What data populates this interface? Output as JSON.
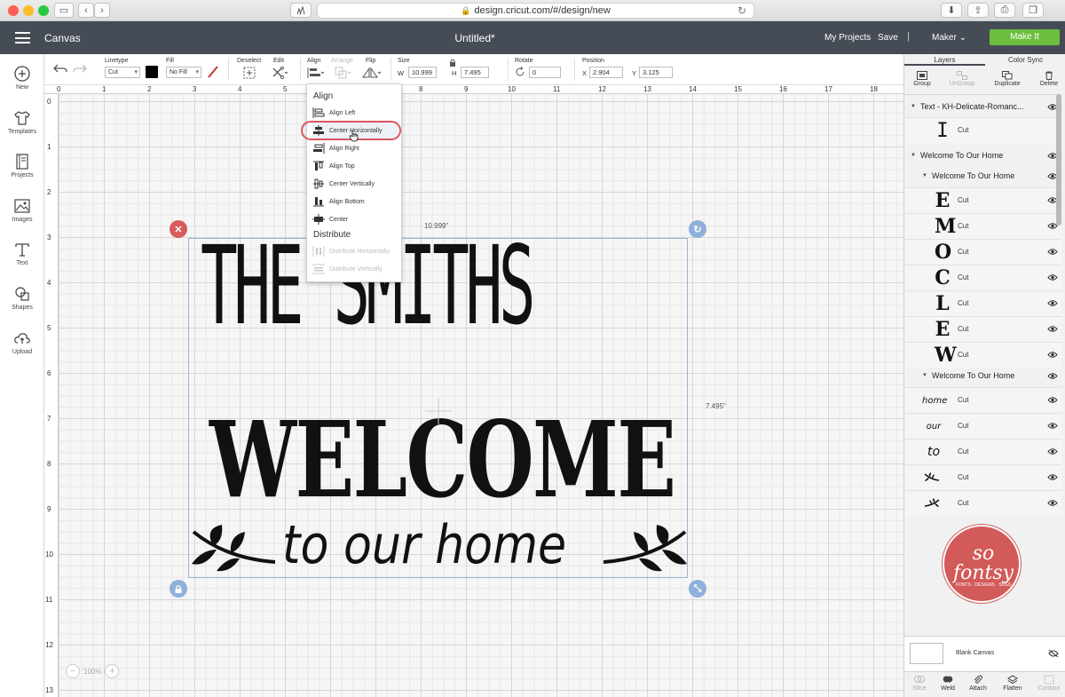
{
  "browser": {
    "url": "design.cricut.com/#/design/new"
  },
  "header": {
    "app_title": "Canvas",
    "doc_title": "Untitled*",
    "my_projects": "My Projects",
    "save": "Save",
    "separator": "|",
    "machine": "Maker",
    "make_it": "Make It"
  },
  "sidebar": {
    "items": [
      {
        "label": "New",
        "icon": "plus-icon"
      },
      {
        "label": "Templates",
        "icon": "shirt-icon"
      },
      {
        "label": "Projects",
        "icon": "notebook-icon"
      },
      {
        "label": "Images",
        "icon": "image-icon"
      },
      {
        "label": "Text",
        "icon": "text-icon"
      },
      {
        "label": "Shapes",
        "icon": "shapes-icon"
      },
      {
        "label": "Upload",
        "icon": "upload-icon"
      }
    ]
  },
  "toolbar": {
    "linetype_label": "Linetype",
    "linetype_value": "Cut",
    "fill_label": "Fill",
    "fill_value": "No Fill",
    "deselect_label": "Deselect",
    "edit_label": "Edit",
    "align_label": "Align",
    "arrange_label": "Arrange",
    "flip_label": "Flip",
    "size_label": "Size",
    "w_label": "W",
    "w_value": "10.999",
    "h_label": "H",
    "h_value": "7.495",
    "rotate_label": "Rotate",
    "rotate_value": "0",
    "position_label": "Position",
    "x_label": "X",
    "x_value": "2.904",
    "y_label": "Y",
    "y_value": "3.125",
    "colors": {
      "linetype_swatch": "#000000",
      "fill_slash": "#c0392b"
    }
  },
  "align_menu": {
    "heading_align": "Align",
    "items": [
      "Align Left",
      "Center Horizontally",
      "Align Right",
      "Align Top",
      "Center Vertically",
      "Align Bottom",
      "Center"
    ],
    "heading_distribute": "Distribute",
    "distribute_items": [
      "Distribute Horizontally",
      "Distribute Vertically"
    ]
  },
  "canvas": {
    "ruler_top": [
      "0",
      "1",
      "2",
      "3",
      "4",
      "5",
      "6",
      "7",
      "8",
      "9",
      "10",
      "11",
      "12",
      "13",
      "14",
      "15",
      "16",
      "17",
      "18"
    ],
    "ruler_left": [
      "0",
      "1",
      "2",
      "3",
      "4",
      "5",
      "6",
      "7",
      "8",
      "9",
      "10",
      "11",
      "12",
      "13"
    ],
    "width_label": "10.999\"",
    "height_label": "7.495\"",
    "zoom": "100%",
    "design": {
      "line1": "THE SMITHS",
      "line2": "WELCOME",
      "line3": "to our home"
    }
  },
  "right_panel": {
    "tabs": [
      "Layers",
      "Color Sync"
    ],
    "tools": [
      "Group",
      "UnGroup",
      "Duplicate",
      "Delete"
    ],
    "layers": {
      "text_group": "Text - KH-Delicate-Romanc...",
      "text_child": {
        "thumb": "I",
        "label": "Cut"
      },
      "group1": "Welcome To Our Home",
      "group1_sub": "Welcome To Our Home",
      "letters": [
        {
          "thumb": "E",
          "label": "Cut"
        },
        {
          "thumb": "M",
          "label": "Cut"
        },
        {
          "thumb": "O",
          "label": "Cut"
        },
        {
          "thumb": "C",
          "label": "Cut"
        },
        {
          "thumb": "L",
          "label": "Cut"
        },
        {
          "thumb": "E",
          "label": "Cut"
        },
        {
          "thumb": "W",
          "label": "Cut"
        }
      ],
      "group2_sub": "Welcome To Our Home",
      "words": [
        {
          "thumb": "home",
          "label": "Cut"
        },
        {
          "thumb": "our",
          "label": "Cut"
        },
        {
          "thumb": "to",
          "label": "Cut"
        },
        {
          "thumb": "leaf",
          "label": "Cut"
        },
        {
          "thumb": "leaf",
          "label": "Cut"
        }
      ]
    },
    "logo": {
      "line1": "so fontsy",
      "line2": "FONTS · DESIGNS · SVGS"
    },
    "blank_canvas": "Blank Canvas",
    "bottom_tools": [
      "Slice",
      "Weld",
      "Attach",
      "Flatten",
      "Contour"
    ]
  }
}
